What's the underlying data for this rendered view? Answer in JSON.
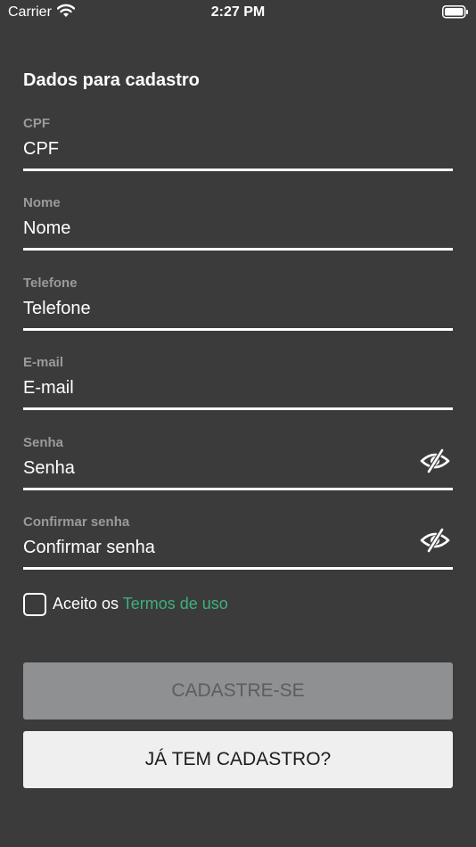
{
  "status_bar": {
    "carrier": "Carrier",
    "time": "2:27 PM"
  },
  "form": {
    "title": "Dados para cadastro",
    "fields": [
      {
        "label": "CPF",
        "placeholder": "CPF"
      },
      {
        "label": "Nome",
        "placeholder": "Nome"
      },
      {
        "label": "Telefone",
        "placeholder": "Telefone"
      },
      {
        "label": "E-mail",
        "placeholder": "E-mail"
      },
      {
        "label": "Senha",
        "placeholder": "Senha",
        "icon": "eye-slash-icon"
      },
      {
        "label": "Confirmar senha",
        "placeholder": "Confirmar senha",
        "icon": "eye-slash-icon"
      }
    ]
  },
  "terms": {
    "prefix": "Aceito os",
    "link": "Termos de uso",
    "checked": false
  },
  "buttons": {
    "register": "CADASTRE-SE",
    "login": "JÁ TEM CADASTRO?"
  },
  "colors": {
    "background": "#3b3b3b",
    "accent": "#3db17e",
    "label": "#9a9a9a",
    "button_disabled": "#8f9092",
    "button_secondary": "#efefef"
  }
}
